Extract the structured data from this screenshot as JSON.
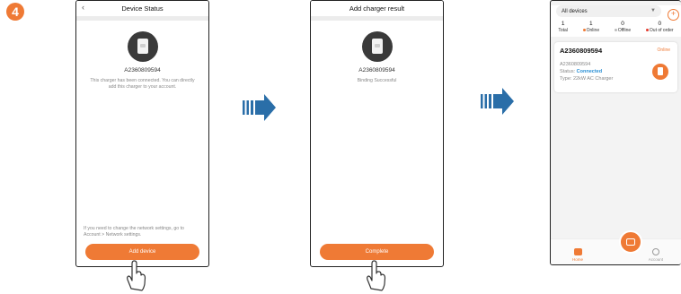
{
  "step": {
    "number": "4"
  },
  "screen1": {
    "title": "Device Status",
    "serial": "A2360809594",
    "message": "This charger has been connected. You can directly add this charger to your account.",
    "network_hint": "If you need to change the network settings, go to Account > Network settings.",
    "button_label": "Add device"
  },
  "screen2": {
    "title": "Add charger result",
    "serial": "A2360809594",
    "message": "Binding Successful",
    "button_label": "Complete"
  },
  "screen3": {
    "filter_label": "All devices",
    "stats": [
      {
        "value": "1",
        "label": "Total",
        "dot": ""
      },
      {
        "value": "1",
        "label": "Online",
        "dot": "#ef7a35"
      },
      {
        "value": "0",
        "label": "Offline",
        "dot": "#bbbbbb"
      },
      {
        "value": "0",
        "label": "Out of order",
        "dot": "#e33b2e"
      }
    ],
    "card": {
      "title": "A2360809594",
      "status": "Online",
      "serial_line": "A2360809594",
      "status_prefix": "Status: ",
      "status_value": "Connected",
      "type_line": "Type: 22kW AC Charger"
    },
    "nav": {
      "home": "Home",
      "account": "Account"
    }
  },
  "colors": {
    "accent": "#ef7a35",
    "arrow": "#2a6ea8",
    "connected": "#2a8fd4"
  },
  "icons": [
    "back-chevron-icon",
    "charger-icon",
    "hand-pointer-icon",
    "arrow-right-icon",
    "add-icon",
    "dropdown-caret-icon",
    "home-icon",
    "account-icon",
    "scan-icon"
  ]
}
